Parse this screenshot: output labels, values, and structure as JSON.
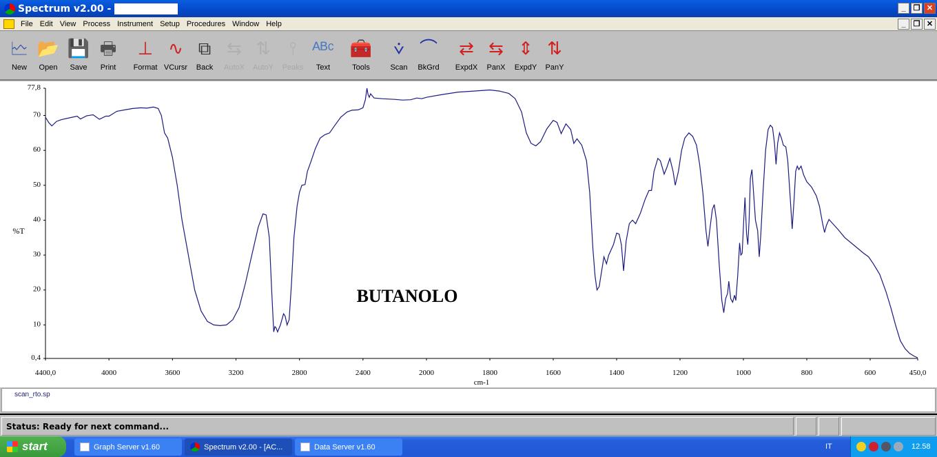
{
  "window": {
    "title": "Spectrum v2.00 -",
    "minimize": "_",
    "restore": "❐",
    "close": "✕"
  },
  "menu": [
    "File",
    "Edit",
    "View",
    "Process",
    "Instrument",
    "Setup",
    "Procedures",
    "Window",
    "Help"
  ],
  "toolbar": [
    {
      "label": "New",
      "icon": "new-spectrum-icon",
      "glyph": "🗠",
      "color": "#3050a0",
      "disabled": false
    },
    {
      "label": "Open",
      "icon": "open-folder-icon",
      "glyph": "📂",
      "color": "#d0a020",
      "disabled": false
    },
    {
      "label": "Save",
      "icon": "save-disk-icon",
      "glyph": "💾",
      "color": "#303030",
      "disabled": false
    },
    {
      "label": "Print",
      "icon": "printer-icon",
      "glyph": "🖶",
      "color": "#505050",
      "disabled": false
    },
    {
      "label": "Format",
      "icon": "format-axes-icon",
      "glyph": "⊥",
      "color": "#d02020",
      "disabled": false
    },
    {
      "label": "VCursr",
      "icon": "vertical-cursor-icon",
      "glyph": "∿",
      "color": "#d02020",
      "disabled": false
    },
    {
      "label": "Back",
      "icon": "back-pages-icon",
      "glyph": "⧉",
      "color": "#303030",
      "disabled": false
    },
    {
      "label": "AutoX",
      "icon": "auto-x-icon",
      "glyph": "⇆",
      "color": "#b0b0b0",
      "disabled": true
    },
    {
      "label": "AutoY",
      "icon": "auto-y-icon",
      "glyph": "⇅",
      "color": "#b0b0b0",
      "disabled": true
    },
    {
      "label": "Peaks",
      "icon": "peaks-icon",
      "glyph": "⫯",
      "color": "#b0b0b0",
      "disabled": true
    },
    {
      "label": "Text",
      "icon": "abc-text-icon",
      "glyph": "ᴬᴮᶜ",
      "color": "#4a7ac0",
      "disabled": false
    },
    {
      "label": "Tools",
      "icon": "toolbox-icon",
      "glyph": "🧰",
      "color": "#304a90",
      "disabled": false
    },
    {
      "label": "Scan",
      "icon": "scan-icon",
      "glyph": "⩒",
      "color": "#2030a0",
      "disabled": false
    },
    {
      "label": "BkGrd",
      "icon": "background-icon",
      "glyph": "⌒",
      "color": "#2030a0",
      "disabled": false
    },
    {
      "label": "ExpdX",
      "icon": "expand-x-icon",
      "glyph": "⇄",
      "color": "#d02020",
      "disabled": false
    },
    {
      "label": "PanX",
      "icon": "pan-x-icon",
      "glyph": "⇆",
      "color": "#d02020",
      "disabled": false
    },
    {
      "label": "ExpdY",
      "icon": "expand-y-icon",
      "glyph": "⇕",
      "color": "#d02020",
      "disabled": false
    },
    {
      "label": "PanY",
      "icon": "pan-y-icon",
      "glyph": "⇅",
      "color": "#d02020",
      "disabled": false
    }
  ],
  "chart_data": {
    "type": "line",
    "title": "BUTANOLO",
    "xlabel": "cm-1",
    "ylabel": "%T",
    "xlim": [
      4400,
      450
    ],
    "x_scale_break": 2000,
    "ylim": [
      0.4,
      77.8
    ],
    "x_ticks": [
      "4400,0",
      "4000",
      "3600",
      "3200",
      "2800",
      "2400",
      "2000",
      "1800",
      "1600",
      "1400",
      "1200",
      "1000",
      "800",
      "600",
      "450,0"
    ],
    "x_tick_values": [
      4400,
      4000,
      3600,
      3200,
      2800,
      2400,
      2000,
      1800,
      1600,
      1400,
      1200,
      1000,
      800,
      600,
      450
    ],
    "y_ticks": [
      "77,8",
      "70",
      "60",
      "50",
      "40",
      "30",
      "20",
      "10",
      "0,4"
    ],
    "y_tick_values": [
      77.8,
      70,
      60,
      50,
      40,
      30,
      20,
      10,
      0.4
    ],
    "line_color": "#1a1a80",
    "series": [
      {
        "name": "scan_rto.sp",
        "points": [
          [
            4400,
            69.5
          ],
          [
            4380,
            68
          ],
          [
            4360,
            67
          ],
          [
            4330,
            68.3
          ],
          [
            4300,
            68.8
          ],
          [
            4250,
            69.3
          ],
          [
            4200,
            69.8
          ],
          [
            4180,
            69
          ],
          [
            4140,
            69.9
          ],
          [
            4100,
            70.2
          ],
          [
            4060,
            68.9
          ],
          [
            4020,
            69.8
          ],
          [
            4000,
            69.8
          ],
          [
            3950,
            71.2
          ],
          [
            3900,
            71.6
          ],
          [
            3850,
            72
          ],
          [
            3800,
            72.2
          ],
          [
            3760,
            72.1
          ],
          [
            3720,
            72.4
          ],
          [
            3690,
            72
          ],
          [
            3670,
            70
          ],
          [
            3650,
            65
          ],
          [
            3630,
            63.5
          ],
          [
            3600,
            58
          ],
          [
            3570,
            50
          ],
          [
            3540,
            40
          ],
          [
            3500,
            30
          ],
          [
            3460,
            20
          ],
          [
            3420,
            14
          ],
          [
            3380,
            11
          ],
          [
            3340,
            10
          ],
          [
            3300,
            9.8
          ],
          [
            3260,
            10
          ],
          [
            3220,
            11.5
          ],
          [
            3180,
            15
          ],
          [
            3140,
            22
          ],
          [
            3100,
            30
          ],
          [
            3060,
            38
          ],
          [
            3030,
            41.8
          ],
          [
            3010,
            41.5
          ],
          [
            2990,
            35
          ],
          [
            2975,
            20
          ],
          [
            2962,
            8
          ],
          [
            2955,
            9.5
          ],
          [
            2948,
            9.2
          ],
          [
            2938,
            8
          ],
          [
            2920,
            10
          ],
          [
            2900,
            13.2
          ],
          [
            2890,
            12.5
          ],
          [
            2878,
            10
          ],
          [
            2865,
            11.5
          ],
          [
            2850,
            22
          ],
          [
            2835,
            35
          ],
          [
            2815,
            44
          ],
          [
            2800,
            48
          ],
          [
            2785,
            50
          ],
          [
            2765,
            50.2
          ],
          [
            2750,
            54
          ],
          [
            2730,
            56.5
          ],
          [
            2700,
            60.5
          ],
          [
            2670,
            63.5
          ],
          [
            2640,
            64.5
          ],
          [
            2610,
            65
          ],
          [
            2580,
            67
          ],
          [
            2540,
            69.5
          ],
          [
            2500,
            71
          ],
          [
            2470,
            71.5
          ],
          [
            2430,
            71.6
          ],
          [
            2400,
            72.2
          ],
          [
            2385,
            74.5
          ],
          [
            2375,
            77.8
          ],
          [
            2368,
            76
          ],
          [
            2360,
            75.2
          ],
          [
            2352,
            76.2
          ],
          [
            2330,
            75
          ],
          [
            2280,
            74.8
          ],
          [
            2200,
            74.6
          ],
          [
            2150,
            74.4
          ],
          [
            2100,
            74.5
          ],
          [
            2060,
            75
          ],
          [
            2030,
            74.8
          ],
          [
            2000,
            75.2
          ],
          [
            1950,
            76
          ],
          [
            1900,
            76.7
          ],
          [
            1850,
            77
          ],
          [
            1800,
            77.3
          ],
          [
            1770,
            77
          ],
          [
            1740,
            76.3
          ],
          [
            1720,
            74.8
          ],
          [
            1700,
            71
          ],
          [
            1685,
            65
          ],
          [
            1670,
            62
          ],
          [
            1655,
            61.3
          ],
          [
            1640,
            62.5
          ],
          [
            1620,
            66.2
          ],
          [
            1600,
            68.6
          ],
          [
            1588,
            68
          ],
          [
            1575,
            64.8
          ],
          [
            1560,
            67.6
          ],
          [
            1545,
            66
          ],
          [
            1535,
            62
          ],
          [
            1525,
            63.3
          ],
          [
            1510,
            61.5
          ],
          [
            1495,
            57
          ],
          [
            1485,
            48
          ],
          [
            1475,
            32
          ],
          [
            1468,
            24
          ],
          [
            1462,
            20
          ],
          [
            1455,
            21
          ],
          [
            1448,
            25
          ],
          [
            1440,
            29.5
          ],
          [
            1432,
            27.5
          ],
          [
            1425,
            30
          ],
          [
            1410,
            33
          ],
          [
            1400,
            36.3
          ],
          [
            1392,
            36
          ],
          [
            1385,
            33
          ],
          [
            1378,
            25.5
          ],
          [
            1370,
            34
          ],
          [
            1360,
            39
          ],
          [
            1350,
            40
          ],
          [
            1340,
            39
          ],
          [
            1325,
            42
          ],
          [
            1310,
            46
          ],
          [
            1298,
            48.5
          ],
          [
            1290,
            48.5
          ],
          [
            1282,
            54
          ],
          [
            1270,
            57.7
          ],
          [
            1262,
            57
          ],
          [
            1250,
            53.2
          ],
          [
            1242,
            55
          ],
          [
            1232,
            57.7
          ],
          [
            1222,
            54
          ],
          [
            1215,
            50
          ],
          [
            1205,
            54
          ],
          [
            1195,
            60
          ],
          [
            1185,
            63.5
          ],
          [
            1172,
            65
          ],
          [
            1160,
            64
          ],
          [
            1148,
            61.5
          ],
          [
            1138,
            56
          ],
          [
            1128,
            48
          ],
          [
            1118,
            37
          ],
          [
            1112,
            32.5
          ],
          [
            1105,
            38
          ],
          [
            1098,
            43
          ],
          [
            1092,
            44.5
          ],
          [
            1085,
            40
          ],
          [
            1076,
            27
          ],
          [
            1068,
            17
          ],
          [
            1062,
            13.5
          ],
          [
            1056,
            17.5
          ],
          [
            1050,
            19
          ],
          [
            1046,
            22.5
          ],
          [
            1040,
            17.5
          ],
          [
            1034,
            16.5
          ],
          [
            1028,
            18.5
          ],
          [
            1024,
            17
          ],
          [
            1018,
            24
          ],
          [
            1012,
            33.5
          ],
          [
            1008,
            30
          ],
          [
            1004,
            30.5
          ],
          [
            999,
            40
          ],
          [
            995,
            46.5
          ],
          [
            990,
            36
          ],
          [
            986,
            33
          ],
          [
            982,
            40
          ],
          [
            978,
            52
          ],
          [
            973,
            54.5
          ],
          [
            968,
            48
          ],
          [
            962,
            40
          ],
          [
            955,
            37
          ],
          [
            950,
            29.5
          ],
          [
            945,
            36
          ],
          [
            938,
            48
          ],
          [
            930,
            60
          ],
          [
            922,
            66
          ],
          [
            915,
            67.2
          ],
          [
            908,
            66.5
          ],
          [
            902,
            62
          ],
          [
            897,
            56
          ],
          [
            892,
            62
          ],
          [
            886,
            65
          ],
          [
            880,
            63.5
          ],
          [
            874,
            61.5
          ],
          [
            866,
            61
          ],
          [
            860,
            57
          ],
          [
            852,
            46
          ],
          [
            846,
            37.5
          ],
          [
            840,
            46
          ],
          [
            835,
            54
          ],
          [
            830,
            55.5
          ],
          [
            825,
            54.5
          ],
          [
            818,
            55.5
          ],
          [
            810,
            53
          ],
          [
            800,
            51
          ],
          [
            785,
            49.5
          ],
          [
            770,
            47
          ],
          [
            760,
            44
          ],
          [
            750,
            39
          ],
          [
            744,
            36.5
          ],
          [
            738,
            38.5
          ],
          [
            730,
            40.2
          ],
          [
            720,
            39.2
          ],
          [
            700,
            37.2
          ],
          [
            680,
            35
          ],
          [
            660,
            33.5
          ],
          [
            640,
            32
          ],
          [
            620,
            30.5
          ],
          [
            605,
            29.5
          ],
          [
            590,
            27.5
          ],
          [
            570,
            24.5
          ],
          [
            550,
            19.5
          ],
          [
            535,
            15
          ],
          [
            520,
            10
          ],
          [
            505,
            5.5
          ],
          [
            490,
            3.2
          ],
          [
            475,
            1.8
          ],
          [
            460,
            1
          ],
          [
            450,
            0.6
          ]
        ]
      }
    ]
  },
  "file_panel": {
    "filename": "scan_rto.sp"
  },
  "status": {
    "text": "Status: Ready for next command..."
  },
  "taskbar": {
    "start": "start",
    "tasks": [
      "Graph Server v1.60",
      "Spectrum v2.00 - [AC...",
      "Data Server v1.60"
    ],
    "language": "IT",
    "clock": "12.58"
  }
}
